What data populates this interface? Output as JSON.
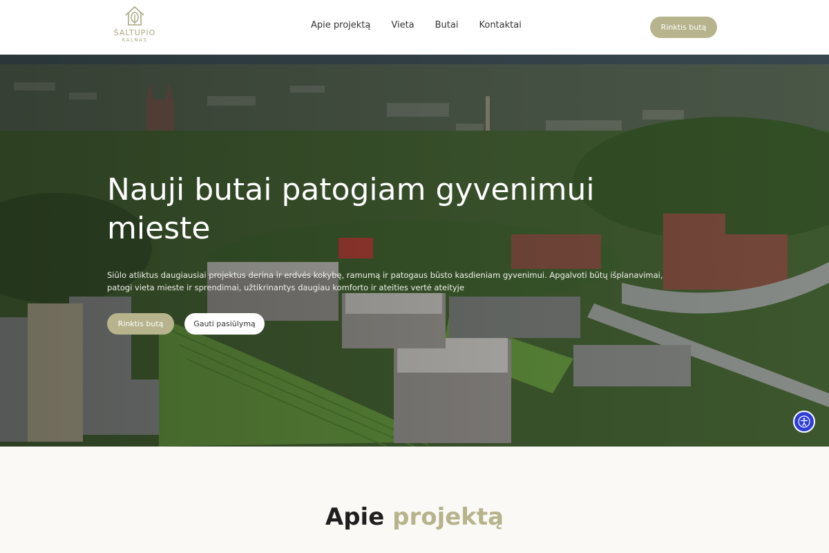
{
  "header": {
    "logo": {
      "line1": "ŠALTUPIO",
      "line2": "KALNAS"
    },
    "nav": [
      {
        "label": "Apie projektą"
      },
      {
        "label": "Vieta"
      },
      {
        "label": "Butai"
      },
      {
        "label": "Kontaktai"
      }
    ],
    "cta_label": "Rinktis butą"
  },
  "hero": {
    "title": "Nauji butai patogiam gyvenimui mieste",
    "description": "Siūlo atliktus daugiausiai projektus derina ir erdvės kokybę, ramumą ir patogaus būsto kasdieniam gyvenimui. Apgalvoti būtų išplanavimai, patogi vieta mieste ir sprendimai, užtikrinantys daugiau komforto ir ateities vertė ateityje",
    "primary_button": "Rinktis butą",
    "secondary_button": "Gauti pasiūlymą"
  },
  "about": {
    "title_part1": "Apie",
    "title_part2": "projektą"
  },
  "colors": {
    "accent": "#b6b38d",
    "accessibility": "#2f3fd6"
  },
  "icons": {
    "logo": "house-tree-icon",
    "accessibility": "accessibility-icon"
  }
}
